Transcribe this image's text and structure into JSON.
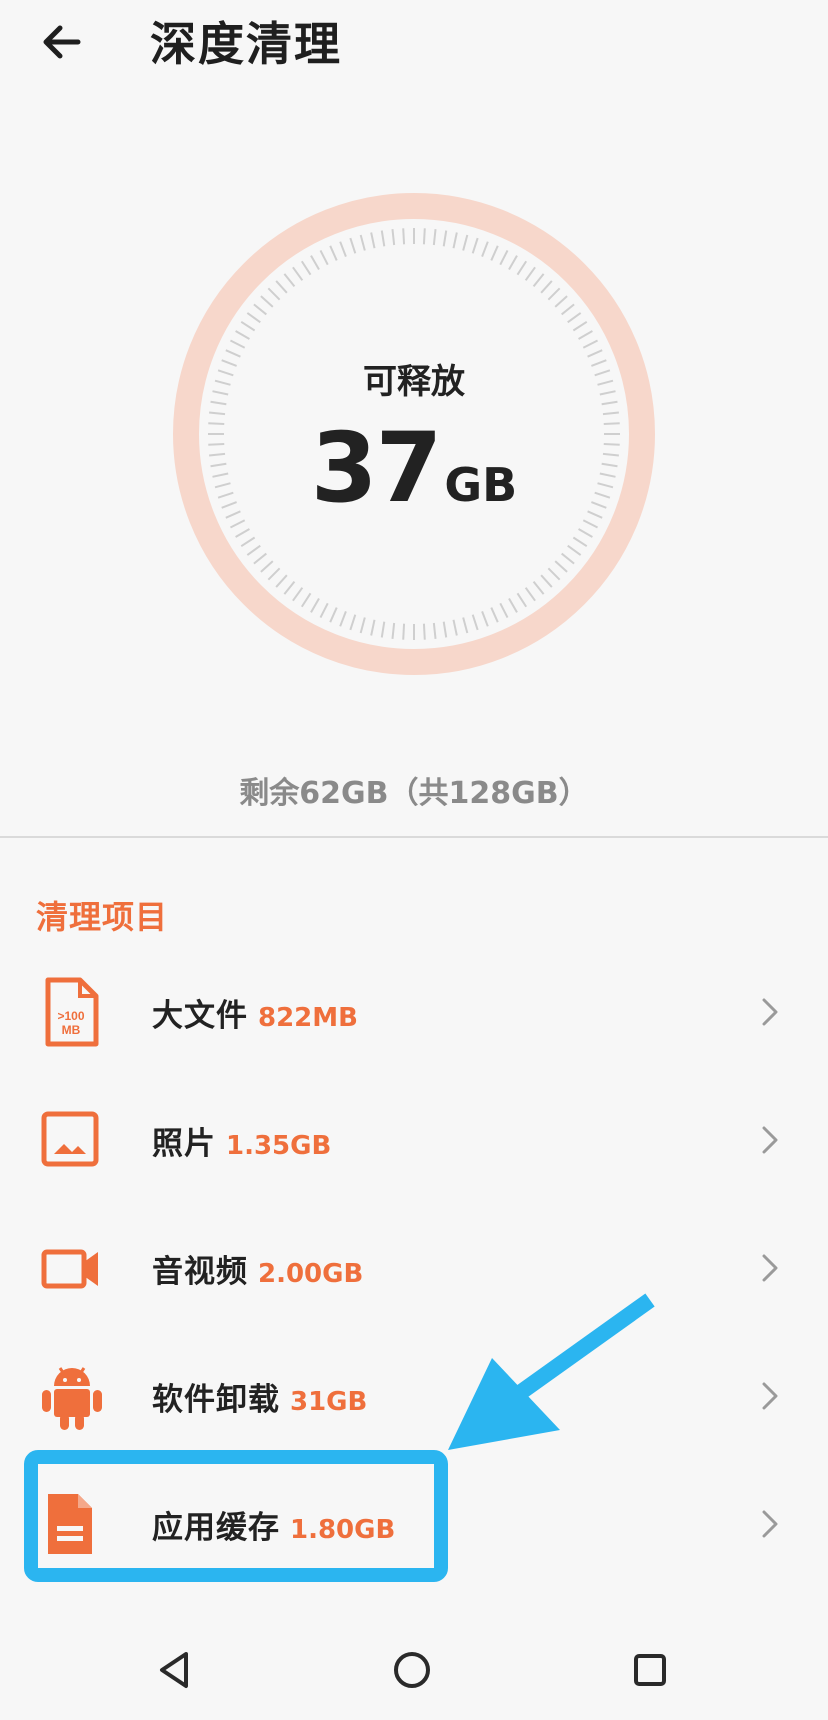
{
  "header": {
    "title": "深度清理",
    "back_icon": "arrow-left-icon"
  },
  "gauge": {
    "label": "可释放",
    "value": "37",
    "unit": "GB",
    "ring_color": "#f7d7cb",
    "tick_color": "#cfcfcf"
  },
  "storage_summary": "剩余62GB（共128GB）",
  "section_title": "清理项目",
  "items": [
    {
      "label": "大文件",
      "size": "822MB",
      "icon": "large-file-icon",
      "icon_text_1": ">100",
      "icon_text_2": "MB"
    },
    {
      "label": "照片",
      "size": "1.35GB",
      "icon": "photo-icon"
    },
    {
      "label": "音视频",
      "size": "2.00GB",
      "icon": "video-icon"
    },
    {
      "label": "软件卸载",
      "size": "31GB",
      "icon": "android-icon"
    },
    {
      "label": "应用缓存",
      "size": "1.80GB",
      "icon": "document-icon"
    }
  ],
  "colors": {
    "accent": "#ef6f3c",
    "annotation": "#2bb5f0",
    "background": "#f7f7f7"
  },
  "nav": {
    "back": "triangle-back-icon",
    "home": "circle-home-icon",
    "recents": "square-recents-icon"
  }
}
